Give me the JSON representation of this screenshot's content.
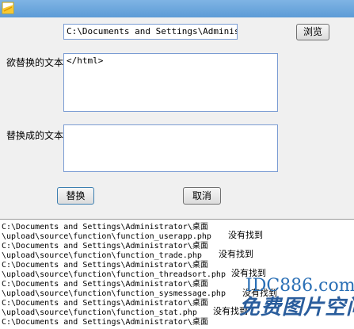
{
  "app": {
    "icon": "note-icon"
  },
  "path_field": {
    "value": "C:\\Documents and Settings\\Administrat"
  },
  "browse_label": "浏览",
  "find_label": "欲替换的文本",
  "find_text": "</html>",
  "replace_label": "替换成的文本",
  "replace_text": "",
  "buttons": {
    "replace": "替换",
    "cancel": "取消"
  },
  "log": {
    "lines": [
      "C:\\Documents and Settings\\Administrator\\桌面",
      "\\upload\\source\\function\\function_userapp.php",
      "C:\\Documents and Settings\\Administrator\\桌面",
      "\\upload\\source\\function\\function_trade.php",
      "C:\\Documents and Settings\\Administrator\\桌面",
      "\\upload\\source\\function\\function_threadsort.php",
      "C:\\Documents and Settings\\Administrator\\桌面",
      "\\upload\\source\\function\\function_sysmessage.php",
      "C:\\Documents and Settings\\Administrator\\桌面",
      "\\upload\\source\\function\\function_stat.php",
      "C:\\Documents and Settings\\Administrator\\桌面"
    ],
    "not_found": [
      "没有找到",
      "没有找到",
      "没有找到",
      "没有找到",
      "没有找到"
    ]
  },
  "watermark": {
    "domain": "IDC886.com",
    "tagline": "免费图片空间"
  }
}
